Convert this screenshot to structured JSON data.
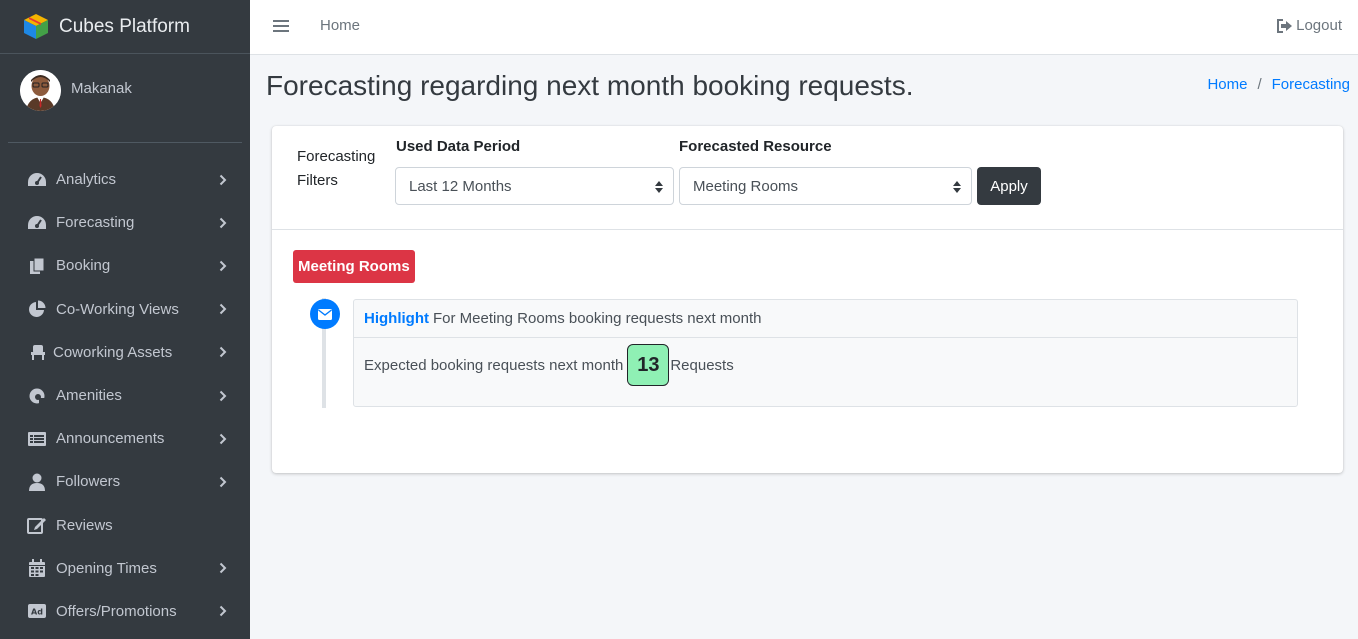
{
  "brand": {
    "name": "Cubes Platform"
  },
  "user": {
    "name": "Makanak"
  },
  "sidebar": {
    "items": [
      {
        "label": "Analytics",
        "icon": "tachometer-icon",
        "has_children": true
      },
      {
        "label": "Forecasting",
        "icon": "tachometer-icon",
        "has_children": true
      },
      {
        "label": "Booking",
        "icon": "copy-icon",
        "has_children": true
      },
      {
        "label": "Co-Working Views",
        "icon": "pie-chart-icon",
        "has_children": true
      },
      {
        "label": "Coworking Assets",
        "icon": "chair-icon",
        "has_children": true
      },
      {
        "label": "Amenities",
        "icon": "amenities-icon",
        "has_children": true
      },
      {
        "label": "Announcements",
        "icon": "list-alt-icon",
        "has_children": true
      },
      {
        "label": "Followers",
        "icon": "user-icon",
        "has_children": true
      },
      {
        "label": "Reviews",
        "icon": "edit-icon",
        "has_children": false
      },
      {
        "label": "Opening Times",
        "icon": "calendar-icon",
        "has_children": true
      },
      {
        "label": "Offers/Promotions",
        "icon": "ad-icon",
        "has_children": true
      }
    ]
  },
  "navbar": {
    "home": "Home",
    "logout": "Logout"
  },
  "page": {
    "title": "Forecasting regarding next month booking requests.",
    "breadcrumb": [
      "Home",
      "Forecasting"
    ]
  },
  "filters": {
    "label": "Forecasting Filters",
    "period_label": "Used Data Period",
    "period_value": "Last 12 Months",
    "resource_label": "Forecasted Resource",
    "resource_value": "Meeting Rooms",
    "apply": "Apply"
  },
  "timeline": {
    "badge": "Meeting Rooms",
    "highlight": "Highlight",
    "header_text": "For Meeting Rooms booking requests next month",
    "body_prefix": "Expected booking requests next month",
    "count": "13",
    "body_suffix": "Requests"
  },
  "colors": {
    "sidebar_bg": "#343a40",
    "primary": "#007bff",
    "danger": "#dc3545",
    "count_bg": "#8ff0b4",
    "apply_bg": "#343a40"
  }
}
